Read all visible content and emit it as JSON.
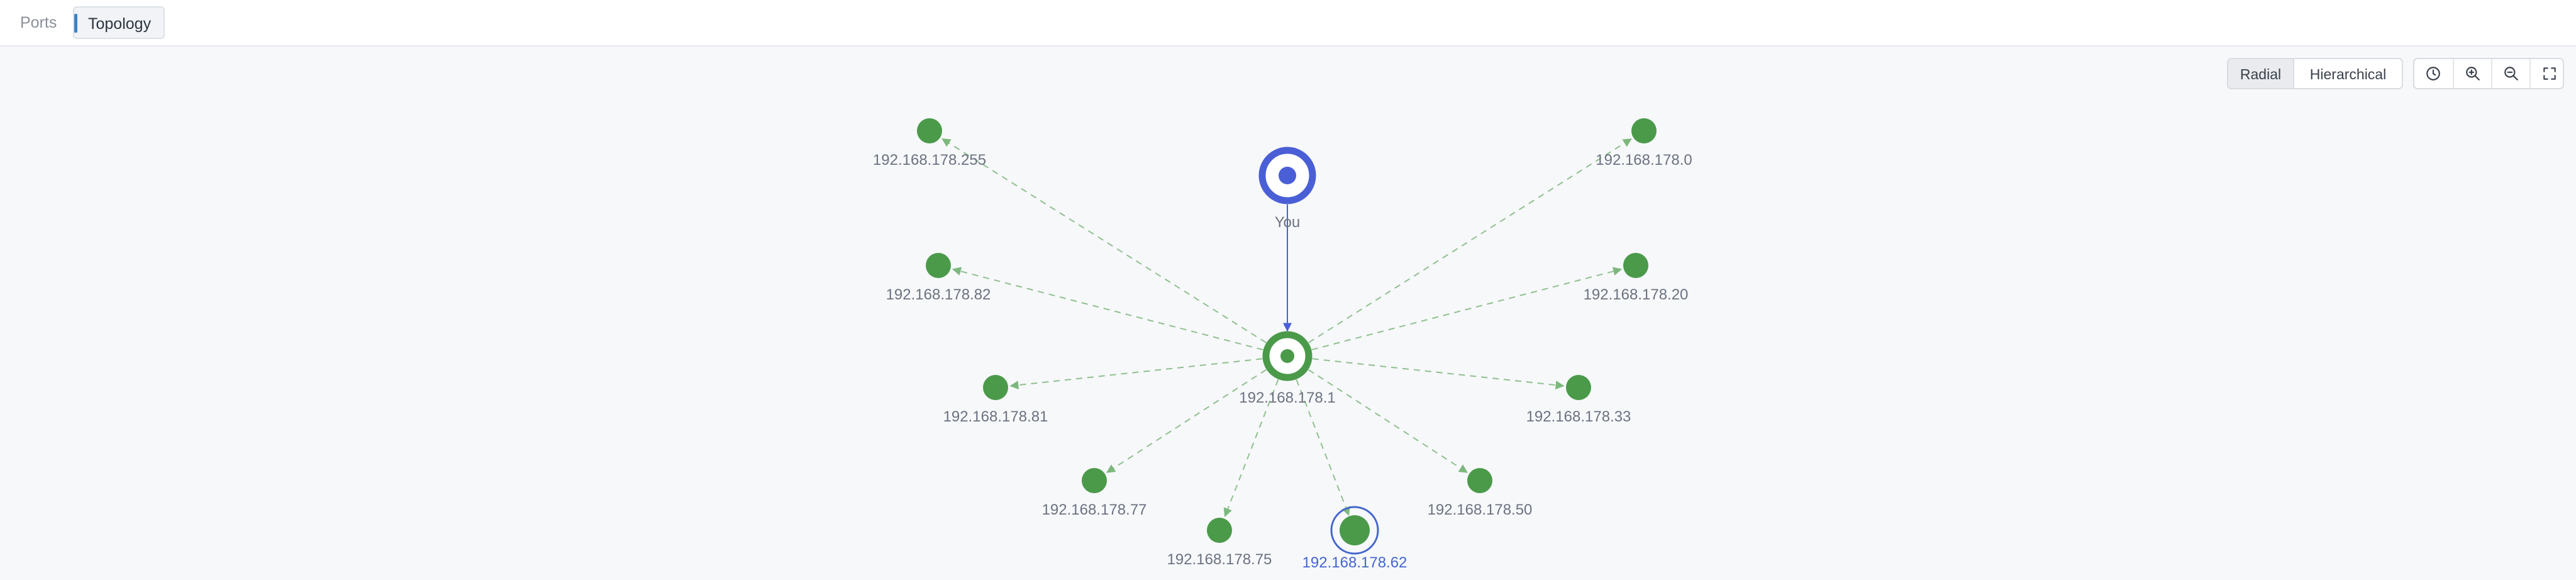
{
  "tabs": [
    {
      "label": "Ports",
      "active": false
    },
    {
      "label": "Topology",
      "active": true
    }
  ],
  "layout_modes": [
    {
      "label": "Radial",
      "active": true
    },
    {
      "label": "Hierarchical",
      "active": false
    }
  ],
  "view_controls": [
    {
      "name": "history-icon"
    },
    {
      "name": "zoom-in-icon"
    },
    {
      "name": "zoom-out-icon"
    },
    {
      "name": "fullscreen-icon"
    }
  ],
  "colors": {
    "node": "#4a9a4a",
    "node_dark": "#3f8a3f",
    "you": "#4a5fd6",
    "edge": "#8fc08f",
    "selected": "#4466cc"
  },
  "topology": {
    "you": {
      "label": "You"
    },
    "gateway": {
      "label": "192.168.178.1"
    },
    "hosts": [
      {
        "label": "192.168.178.255",
        "selected": false
      },
      {
        "label": "192.168.178.0",
        "selected": false
      },
      {
        "label": "192.168.178.82",
        "selected": false
      },
      {
        "label": "192.168.178.20",
        "selected": false
      },
      {
        "label": "192.168.178.81",
        "selected": false
      },
      {
        "label": "192.168.178.33",
        "selected": false
      },
      {
        "label": "192.168.178.77",
        "selected": false
      },
      {
        "label": "192.168.178.50",
        "selected": false
      },
      {
        "label": "192.168.178.75",
        "selected": false
      },
      {
        "label": "192.168.178.62",
        "selected": true
      }
    ]
  }
}
